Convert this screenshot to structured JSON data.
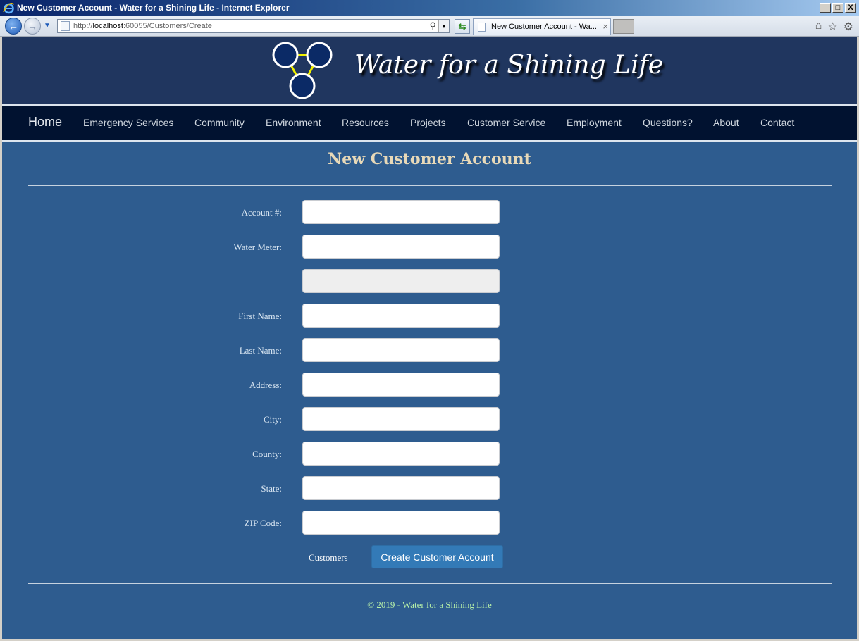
{
  "window": {
    "title": "New Customer Account - Water for a Shining Life - Internet Explorer",
    "minimize": "_",
    "maximize": "□",
    "close": "X"
  },
  "browser": {
    "url_prefix": "http://",
    "url_host": "localhost",
    "url_rest": ":60055/Customers/Create",
    "tab_label": "New Customer Account - Wa...",
    "tab_close": "×"
  },
  "site": {
    "title": "Water for a Shining Life"
  },
  "nav": {
    "items": [
      "Home",
      "Emergency Services",
      "Community",
      "Environment",
      "Resources",
      "Projects",
      "Customer Service",
      "Employment",
      "Questions?",
      "About",
      "Contact"
    ]
  },
  "page": {
    "heading": "New Customer Account"
  },
  "form": {
    "fields": [
      {
        "label": "Account #:",
        "value": ""
      },
      {
        "label": "Water Meter:",
        "value": ""
      },
      {
        "label": "",
        "value": "",
        "readonly": true
      },
      {
        "label": "First Name:",
        "value": ""
      },
      {
        "label": "Last Name:",
        "value": ""
      },
      {
        "label": "Address:",
        "value": ""
      },
      {
        "label": "City:",
        "value": ""
      },
      {
        "label": "County:",
        "value": ""
      },
      {
        "label": "State:",
        "value": ""
      },
      {
        "label": "ZIP Code:",
        "value": ""
      }
    ],
    "customers_link": "Customers",
    "submit_label": "Create Customer Account"
  },
  "footer": {
    "text": "© 2019 - Water for a Shining Life"
  },
  "colors": {
    "page_bg": "#2e5c8f",
    "banner_bg": "#20365f",
    "navbar_bg": "#011230",
    "heading": "#e8d9b8",
    "footer_text": "#b7f0a8",
    "button": "#337ab7"
  }
}
